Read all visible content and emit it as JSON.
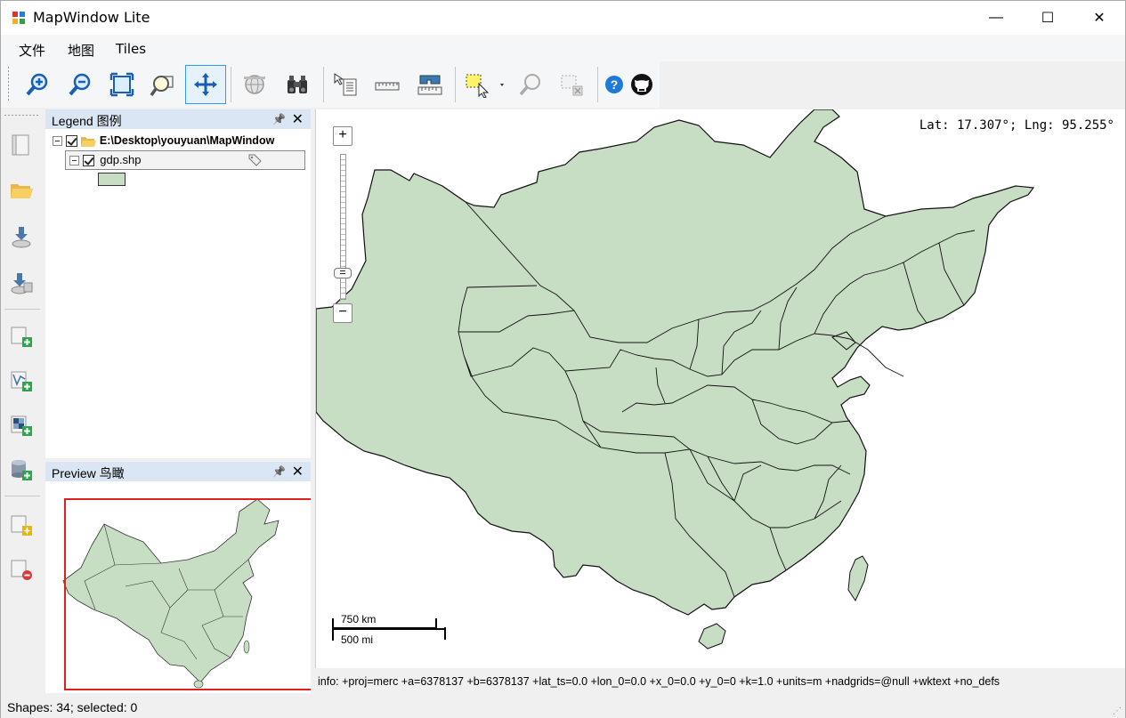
{
  "window": {
    "title": "MapWindow Lite",
    "minimize_glyph": "—",
    "maximize_glyph": "☐",
    "close_glyph": "✕"
  },
  "menu": {
    "items": [
      {
        "label": "文件"
      },
      {
        "label": "地图"
      },
      {
        "label": "Tiles"
      }
    ]
  },
  "toolbar": {
    "buttons": [
      {
        "icon": "zoom-in-icon"
      },
      {
        "icon": "zoom-out-icon"
      },
      {
        "icon": "zoom-extent-icon"
      },
      {
        "icon": "zoom-layer-icon"
      },
      {
        "icon": "pan-icon",
        "active": true
      },
      {
        "icon": "globe-icon",
        "disabled": true
      },
      {
        "icon": "binoculars-icon"
      },
      {
        "icon": "identify-icon"
      },
      {
        "icon": "ruler-icon"
      },
      {
        "icon": "measure-area-icon"
      },
      {
        "icon": "select-icon"
      },
      {
        "icon": "zoom-selected-icon",
        "disabled": true
      },
      {
        "icon": "clear-selection-icon",
        "disabled": true
      },
      {
        "icon": "help-icon"
      },
      {
        "icon": "github-icon"
      }
    ]
  },
  "legend": {
    "title": "Legend 图例",
    "pin_glyph": "📌",
    "close_glyph": "✕",
    "group_label": "E:\\Desktop\\youyuan\\MapWindow",
    "layer_label": "gdp.shp",
    "symbol_color": "#c8dec4"
  },
  "preview": {
    "title": "Preview 鸟瞰",
    "pin_glyph": "📌",
    "close_glyph": "✕",
    "extent_color": "#e02020"
  },
  "map": {
    "coordinate_readout": "Lat: 17.307°; Lng: 95.255°",
    "fill_color": "#c8dec4",
    "zoom_in_glyph": "+",
    "zoom_out_glyph": "−",
    "scale_km": "750 km",
    "scale_mi": "500 mi"
  },
  "info": {
    "text": "info: +proj=merc +a=6378137 +b=6378137 +lat_ts=0.0 +lon_0=0.0 +x_0=0.0 +y_0=0 +k=1.0 +units=m +nadgrids=@null +wktext +no_defs"
  },
  "status": {
    "text": "Shapes: 34; selected: 0"
  }
}
